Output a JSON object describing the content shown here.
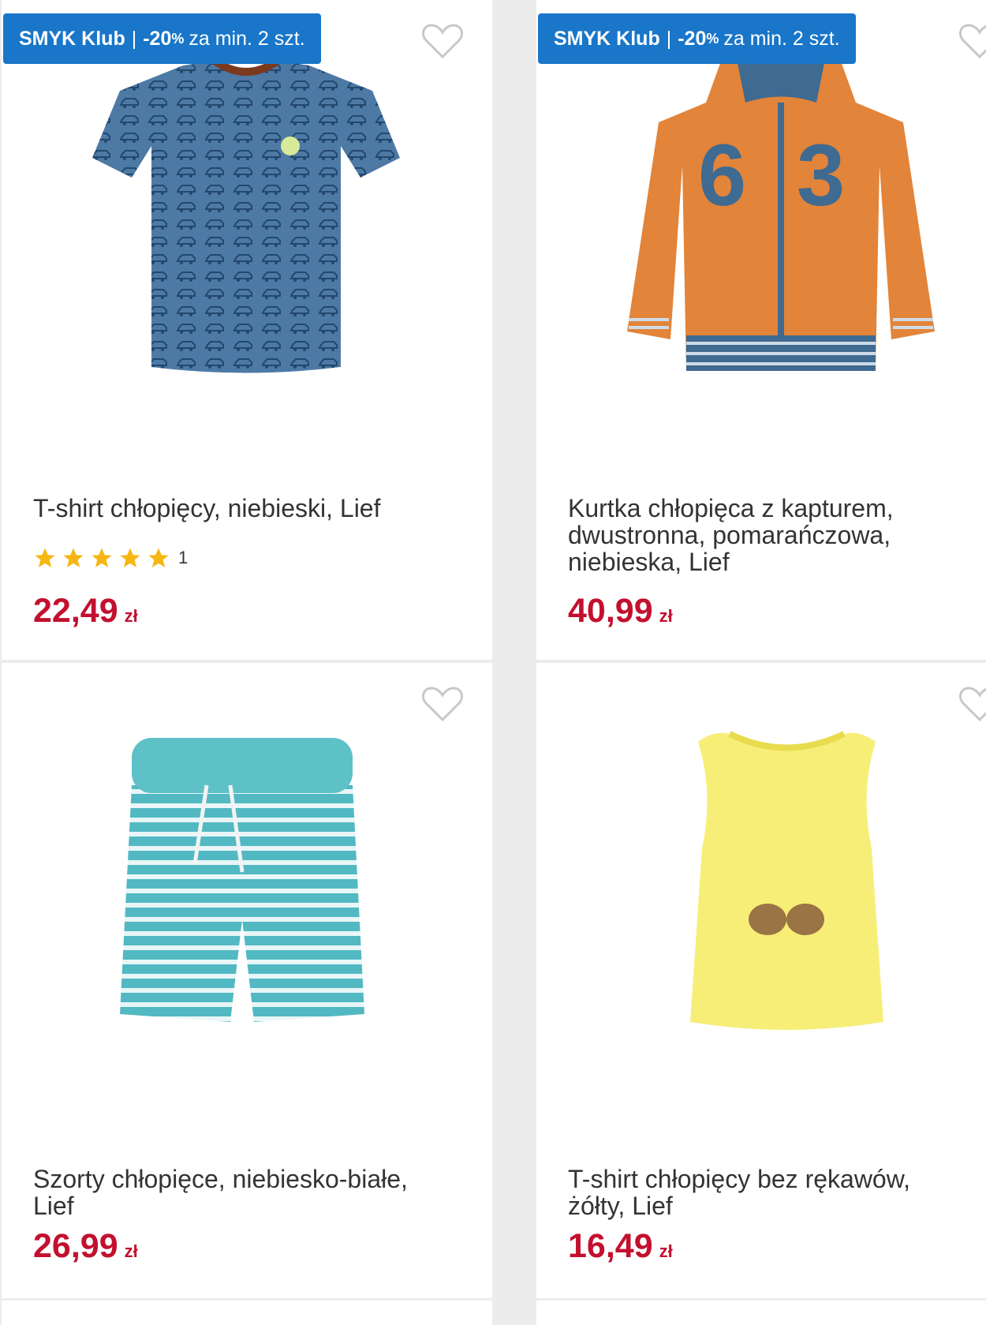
{
  "promo_badge": {
    "brand": "SMYK Klub",
    "separator": "|",
    "discount": "-20",
    "percent": "%",
    "condition": "za min. 2 szt."
  },
  "currency": "zł",
  "colors": {
    "badge_bg": "#1976c9",
    "price": "#c3102f",
    "star": "#f6b714",
    "heart_outline": "#c8c8c8"
  },
  "products": [
    {
      "title": "T-shirt chłopięcy, niebieski, Lief",
      "price": "22,49",
      "rating_stars": 5,
      "rating_count": "1",
      "has_badge": true,
      "favorite_icon": "heart-outline-icon"
    },
    {
      "title": "Kurtka chłopięca z kapturem, dwustronna, pomarańczowa, niebieska, Lief",
      "price": "40,99",
      "has_badge": true,
      "favorite_icon": "heart-outline-icon"
    },
    {
      "title": "Szorty chłopięce, niebiesko-białe, Lief",
      "price": "26,99",
      "has_badge": false,
      "favorite_icon": "heart-outline-icon"
    },
    {
      "title": "T-shirt chłopięcy bez rękawów, żółty, Lief",
      "price": "16,49",
      "has_badge": false,
      "favorite_icon": "heart-outline-icon"
    }
  ]
}
